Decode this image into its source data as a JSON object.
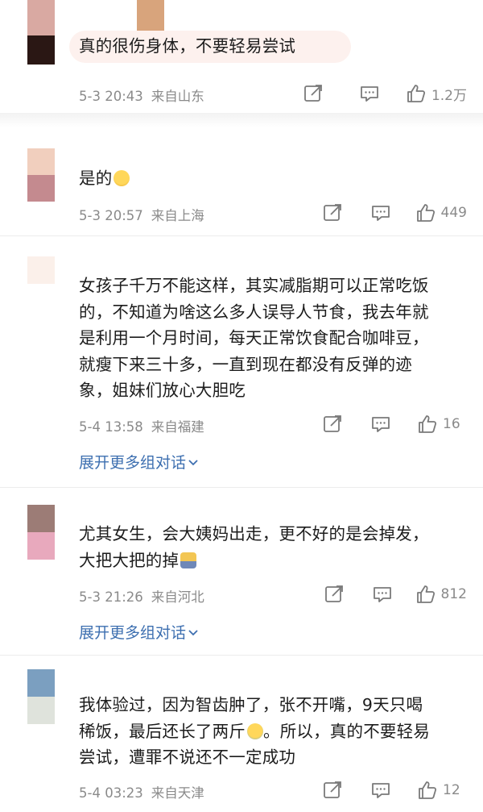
{
  "comments": [
    {
      "text": "真的很伤身体，不要轻易尝试",
      "date": "5-3 20:43",
      "location": "来自山东",
      "likes": "1.2万",
      "avatar_colors": [
        "#d9a9a2",
        "#2a1714"
      ],
      "top_avatar_color": "#d8a47c"
    },
    {
      "text": "是的",
      "emoji": "crying-emoji",
      "date": "5-3 20:57",
      "location": "来自上海",
      "likes": "449",
      "avatar_colors": [
        "#f1cfbe",
        "#c48a8f"
      ]
    },
    {
      "text": "女孩子千万不能这样，其实减脂期可以正常吃饭的，不知道为啥这么多人误导人节食，我去年就是利用一个月时间，每天正常饮食配合咖啡豆，就瘦下来三十多，一直到现在都没有反弹的迹象，姐妹们放心大胆吃",
      "lines": [
        "女孩子千万不能这样，其实减脂期可以正常吃饭",
        "的，不知道为啥这么多人误导人节食，我去年就",
        "是利用一个月时间，每天正常饮食配合咖啡豆，",
        "就瘦下来三十多，一直到现在都没有反弹的迹",
        "象，姐妹们放心大胆吃"
      ],
      "date": "5-4 13:58",
      "location": "来自福建",
      "likes": "16",
      "expand_label": "展开更多组对话",
      "avatar_colors": [
        "#fbf0ea"
      ]
    },
    {
      "lines": [
        "尤其女生，会大姨妈出走，更不好的是会掉发，",
        "大把大把的掉"
      ],
      "emoji": "sad-emoji",
      "date": "5-3 21:26",
      "location": "来自河北",
      "likes": "812",
      "expand_label": "展开更多组对话",
      "avatar_colors": [
        "#9c7c76",
        "#e8a9bd"
      ]
    },
    {
      "lines": [
        "我体验过，因为智齿肿了，张不开嘴，9天只喝",
        "稀饭，最后还长了两斤",
        "。所以，真的不要轻易",
        "尝试，遭罪不说还不一定成功"
      ],
      "emoji": "laughing-crying-emoji",
      "date": "5-4 03:23",
      "location": "来自天津",
      "likes": "12",
      "avatar_colors": [
        "#7b9fc0",
        "#dfe3dc"
      ]
    }
  ],
  "icons": {
    "share": "share-icon",
    "comment": "comment-icon",
    "like": "thumbs-up-icon",
    "expand": "chevron-down-icon"
  },
  "colors": {
    "link": "#3d6fb0",
    "meta": "#8a8a8a",
    "highlight": "#fdf1ee"
  }
}
